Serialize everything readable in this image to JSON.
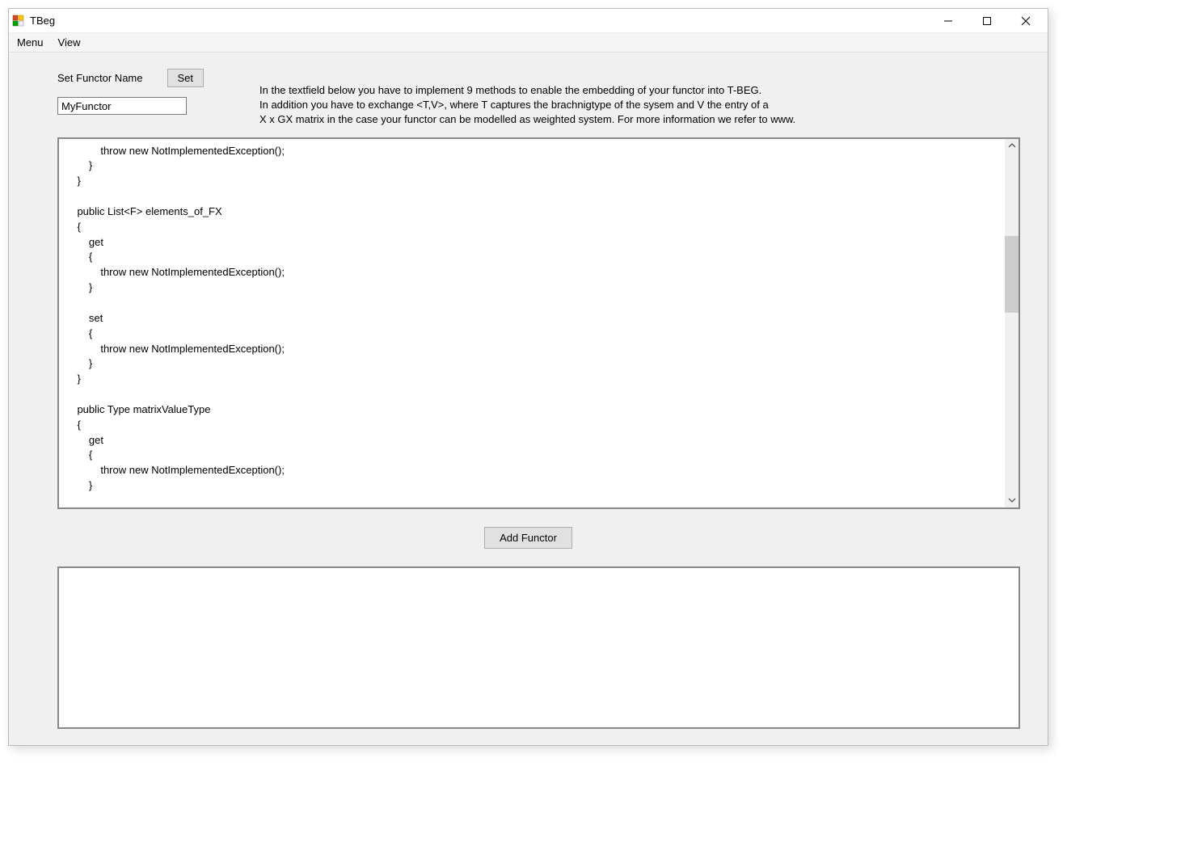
{
  "title": "TBeg",
  "menubar": {
    "menu": "Menu",
    "view": "View"
  },
  "top": {
    "label": "Set Functor Name",
    "set_btn": "Set",
    "input_value": "MyFunctor",
    "instructions_line1": "In the textfield below you have to implement 9 methods to enable the embedding of your functor into T-BEG.",
    "instructions_line2": "In addition you have to exchange <T,V>, where T captures the brachnigtype of the sysem and V the entry of a",
    "instructions_line3": " X x GX matrix in the case your functor can be modelled as weighted system. For more information we refer to www."
  },
  "code": "            throw new NotImplementedException();\n        }\n    }\n\n    public List<F> elements_of_FX\n    {\n        get\n        {\n            throw new NotImplementedException();\n        }\n\n        set\n        {\n            throw new NotImplementedException();\n        }\n    }\n\n    public Type matrixValueType\n    {\n        get\n        {\n            throw new NotImplementedException();\n        }\n\n        set\n        {",
  "buttons": {
    "add_functor": "Add Functor"
  }
}
